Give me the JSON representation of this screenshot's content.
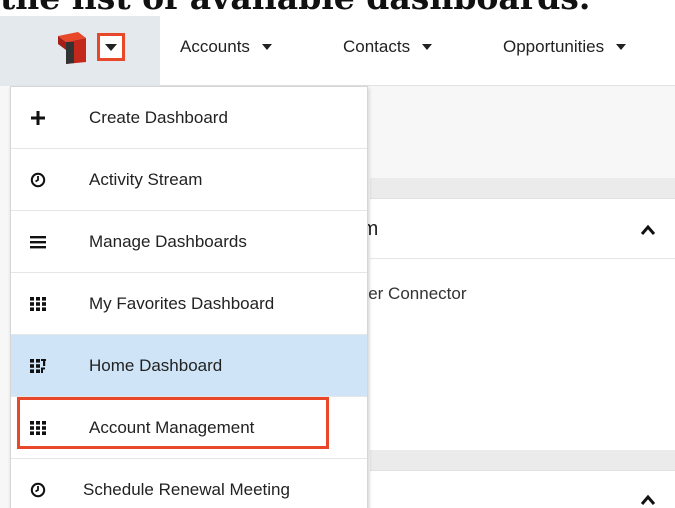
{
  "caption": "the list of available dashboards.",
  "nav": {
    "items": [
      {
        "label": "Accounts"
      },
      {
        "label": "Contacts"
      },
      {
        "label": "Opportunities"
      }
    ]
  },
  "background": {
    "panel_title": "rm",
    "panel_text": "itter Connector"
  },
  "menu": {
    "items": [
      {
        "label": "Create Dashboard",
        "icon": "plus-icon"
      },
      {
        "label": "Activity Stream",
        "icon": "clock-icon"
      },
      {
        "label": "Manage Dashboards",
        "icon": "list-icon"
      },
      {
        "label": "My Favorites Dashboard",
        "icon": "grid-icon"
      },
      {
        "label": "Home Dashboard",
        "icon": "dashboard-grid-icon",
        "active": true
      },
      {
        "label": "Account Management",
        "icon": "grid-icon",
        "highlighted": true
      },
      {
        "label": "Schedule Renewal Meeting",
        "icon": "clock-icon"
      }
    ]
  },
  "colors": {
    "highlight": "#e8472a",
    "active_bg": "#cfe5f7",
    "logo_cell": "#e4e9ee"
  }
}
